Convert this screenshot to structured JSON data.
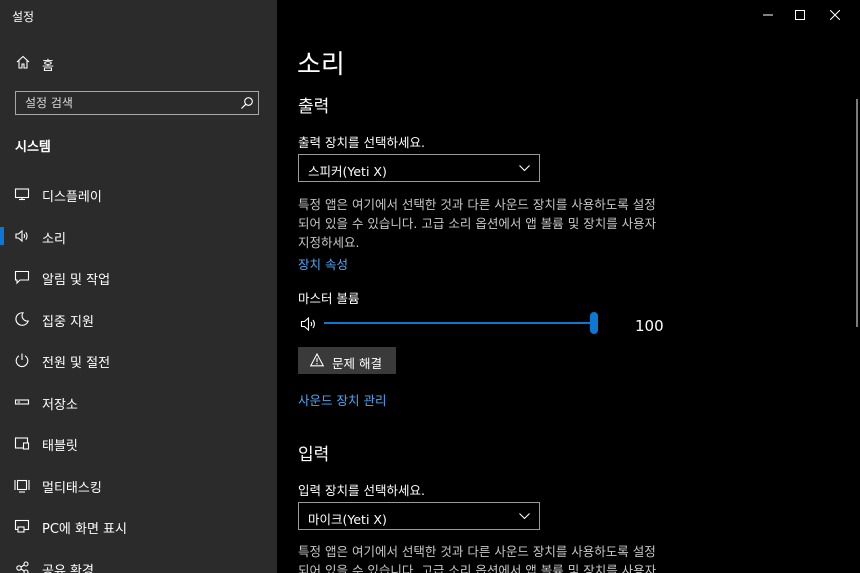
{
  "window": {
    "title": "설정",
    "controls": [
      "minimize-icon",
      "maximize-icon",
      "close-icon"
    ]
  },
  "sidebar": {
    "home_label": "홈",
    "search_placeholder": "설정 검색",
    "section_heading": "시스템",
    "items": [
      {
        "label": "디스플레이",
        "icon": "monitor-icon",
        "selected": false
      },
      {
        "label": "소리",
        "icon": "speaker-icon",
        "selected": true
      },
      {
        "label": "알림 및 작업",
        "icon": "notification-icon",
        "selected": false
      },
      {
        "label": "집중 지원",
        "icon": "moon-icon",
        "selected": false
      },
      {
        "label": "전원 및 절전",
        "icon": "power-icon",
        "selected": false
      },
      {
        "label": "저장소",
        "icon": "storage-icon",
        "selected": false
      },
      {
        "label": "태블릿",
        "icon": "tablet-icon",
        "selected": false
      },
      {
        "label": "멀티태스킹",
        "icon": "multitasking-icon",
        "selected": false
      },
      {
        "label": "PC에 화면 표시",
        "icon": "project-icon",
        "selected": false
      },
      {
        "label": "공유 환경",
        "icon": "shared-experiences-icon",
        "selected": false
      }
    ]
  },
  "main": {
    "page_title": "소리",
    "output": {
      "heading": "출력",
      "device_label": "출력 장치를 선택하세요.",
      "device_value": "스피커(Yeti X)",
      "description_lines": [
        "특정 앱은 여기에서 선택한 것과 다른 사운드 장치를 사용하도록 설정",
        "되어 있을 수 있습니다. 고급 소리 옵션에서 앱 볼륨 및 장치를 사용자",
        "지정하세요."
      ],
      "device_properties_link": "장치 속성",
      "master_volume_label": "마스터 볼륨",
      "master_volume_value": "100",
      "master_volume_level": 1.0,
      "troubleshoot_button": "문제 해결",
      "manage_devices_link": "사운드 장치 관리"
    },
    "input": {
      "heading": "입력",
      "device_label": "입력 장치를 선택하세요.",
      "device_value": "마이크(Yeti X)",
      "description_lines": [
        "특정 앱은 여기에서 선택한 것과 다른 사운드 장치를 사용하도록 설정",
        "되어 있을 수 있습니다. 고급 소리 옵션에서 앱 볼륨 및 장치를 사용자"
      ]
    }
  },
  "colors": {
    "accent": "#0a78d4",
    "link": "#4ea6f0",
    "sidebar_bg": "#2b2b2b",
    "content_bg": "#000000"
  }
}
